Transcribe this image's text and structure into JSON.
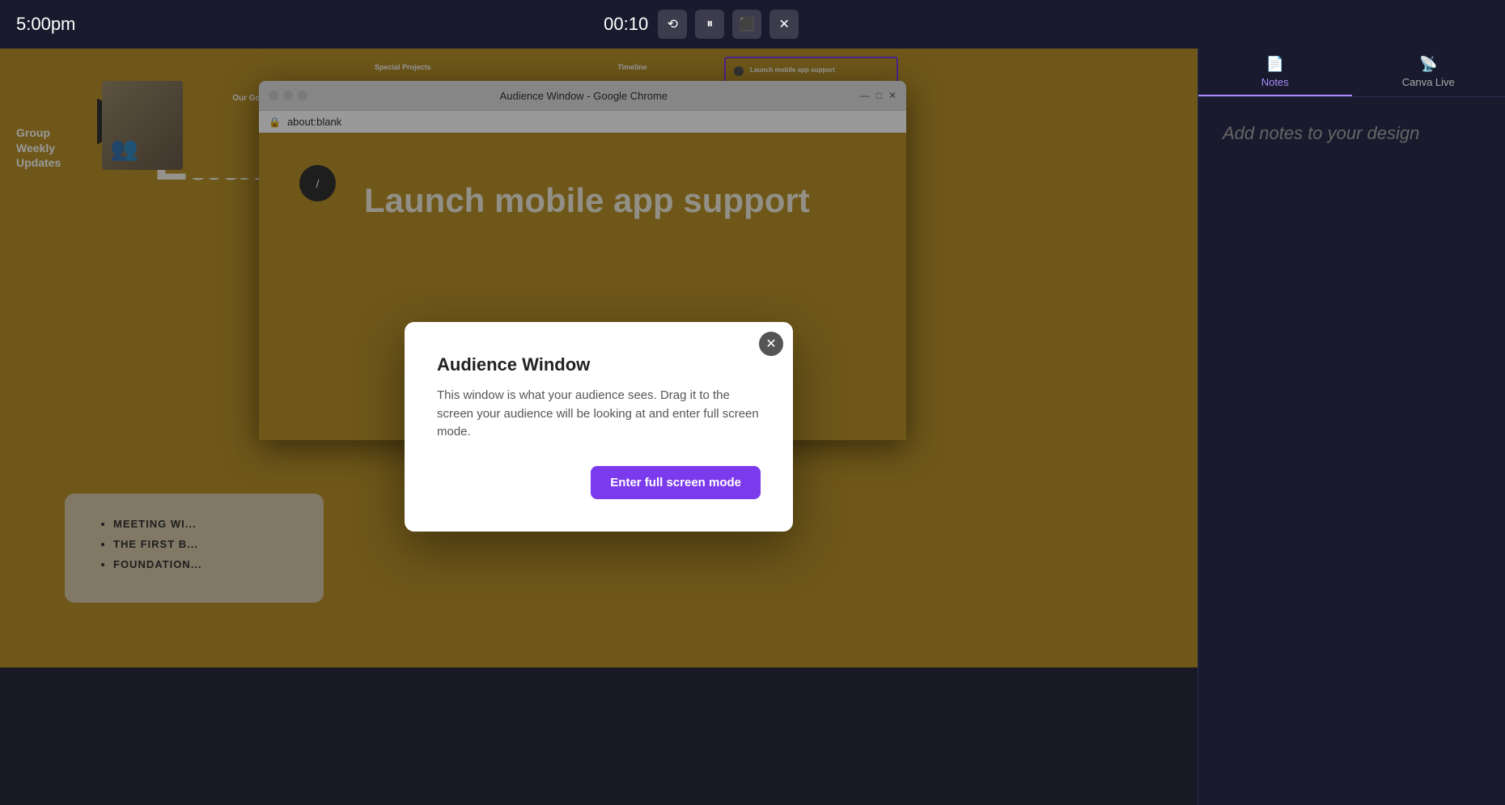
{
  "topbar": {
    "time": "5:00pm",
    "timer": "00:10",
    "rewind_label": "⟲",
    "pause_label": "⏸",
    "captions_label": "⬜",
    "close_label": "✕"
  },
  "chrome_window": {
    "title": "Audience Window - Google Chrome",
    "address": "about:blank",
    "minimize": "—",
    "maximize": "□",
    "close": "✕"
  },
  "modal": {
    "title": "Audience Window",
    "description": "This window is what your audience sees. Drag it to the screen your audience will be looking at and enter full screen mode.",
    "close_label": "✕",
    "fullscreen_btn": "Enter full screen mode"
  },
  "slide": {
    "number": "/",
    "title": "Launc",
    "bullet1": "MEETING WI...",
    "bullet2": "THE FIRST B...",
    "bullet3": "FOUNDATION..."
  },
  "chrome_slide": {
    "number": "/",
    "title": "Launch mobile app support"
  },
  "notes_panel": {
    "notes_tab": "Notes",
    "canva_live_tab": "Canva Live",
    "placeholder": "Add notes to your design"
  },
  "thumbnails": {
    "first_label": "Group\nWeekly\nUpdates",
    "thumb2_title": "Our Goals at a Glance",
    "thumb3_title": "Special Projects",
    "thumb4_title": "Timeline",
    "thumb5_title": "Launch mobile app support",
    "nav_next": "›"
  }
}
